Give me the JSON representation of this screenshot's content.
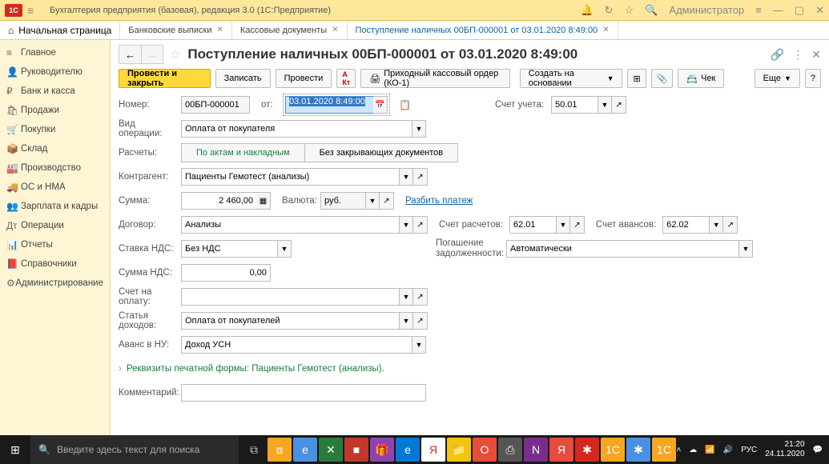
{
  "topbar": {
    "logo_text": "1С",
    "title": "Бухгалтерия предприятия (базовая), редакция 3.0  (1С:Предприятие)",
    "user": "Администратор"
  },
  "tabs": {
    "home": "Начальная страница",
    "items": [
      {
        "label": "Банковские выписки"
      },
      {
        "label": "Кассовые документы"
      },
      {
        "label": "Поступление наличных 00БП-000001 от 03.01.2020 8:49:00"
      }
    ]
  },
  "sidebar": {
    "items": [
      {
        "icon": "≡",
        "label": "Главное"
      },
      {
        "icon": "👤",
        "label": "Руководителю"
      },
      {
        "icon": "₽",
        "label": "Банк и касса"
      },
      {
        "icon": "🛍",
        "label": "Продажи"
      },
      {
        "icon": "🛒",
        "label": "Покупки"
      },
      {
        "icon": "📦",
        "label": "Склад"
      },
      {
        "icon": "🏭",
        "label": "Производство"
      },
      {
        "icon": "🚚",
        "label": "ОС и НМА"
      },
      {
        "icon": "👥",
        "label": "Зарплата и кадры"
      },
      {
        "icon": "Дт",
        "label": "Операции"
      },
      {
        "icon": "📊",
        "label": "Отчеты"
      },
      {
        "icon": "📕",
        "label": "Справочники"
      },
      {
        "icon": "⚙",
        "label": "Администрирование"
      }
    ]
  },
  "doc": {
    "title": "Поступление наличных 00БП-000001 от 03.01.2020 8:49:00",
    "toolbar": {
      "post_close": "Провести и закрыть",
      "save": "Записать",
      "post": "Провести",
      "print_order": "Приходный кассовый ордер (КО-1)",
      "create_based": "Создать на основании",
      "check": "Чек",
      "more": "Еще"
    },
    "fields": {
      "number_label": "Номер:",
      "number": "00БП-000001",
      "from_label": "от:",
      "date": "03.01.2020  8:49:00",
      "account_label": "Счет учета:",
      "account": "50.01",
      "op_type_label": "Вид операции:",
      "op_type": "Оплата от покупателя",
      "settlements_label": "Расчеты:",
      "seg1": "По актам и накладным",
      "seg2": "Без закрывающих документов",
      "counterparty_label": "Контрагент:",
      "counterparty": "Пациенты Гемотест (анализы)",
      "sum_label": "Сумма:",
      "sum": "2 460,00",
      "currency_label": "Валюта:",
      "currency": "руб.",
      "split_link": "Разбить платеж",
      "contract_label": "Договор:",
      "contract": "Анализы",
      "acc_settl_label": "Счет расчетов:",
      "acc_settl": "62.01",
      "acc_advance_label": "Счет авансов:",
      "acc_advance": "62.02",
      "vat_rate_label": "Ставка НДС:",
      "vat_rate": "Без НДС",
      "debt_label": "Погашение задолженности:",
      "debt": "Автоматически",
      "vat_sum_label": "Сумма НДС:",
      "vat_sum": "0,00",
      "invoice_label": "Счет на оплату:",
      "income_label": "Статья доходов:",
      "income": "Оплата от покупателей",
      "advance_nu_label": "Аванс в НУ:",
      "advance_nu": "Доход УСН",
      "print_form": "Реквизиты печатной формы: Пациенты Гемотест (анализы).",
      "comment_label": "Комментарий:"
    }
  },
  "taskbar": {
    "search_placeholder": "Введите здесь текст для поиска",
    "time": "21:20",
    "date": "24.11.2020",
    "lang": "РУС"
  }
}
